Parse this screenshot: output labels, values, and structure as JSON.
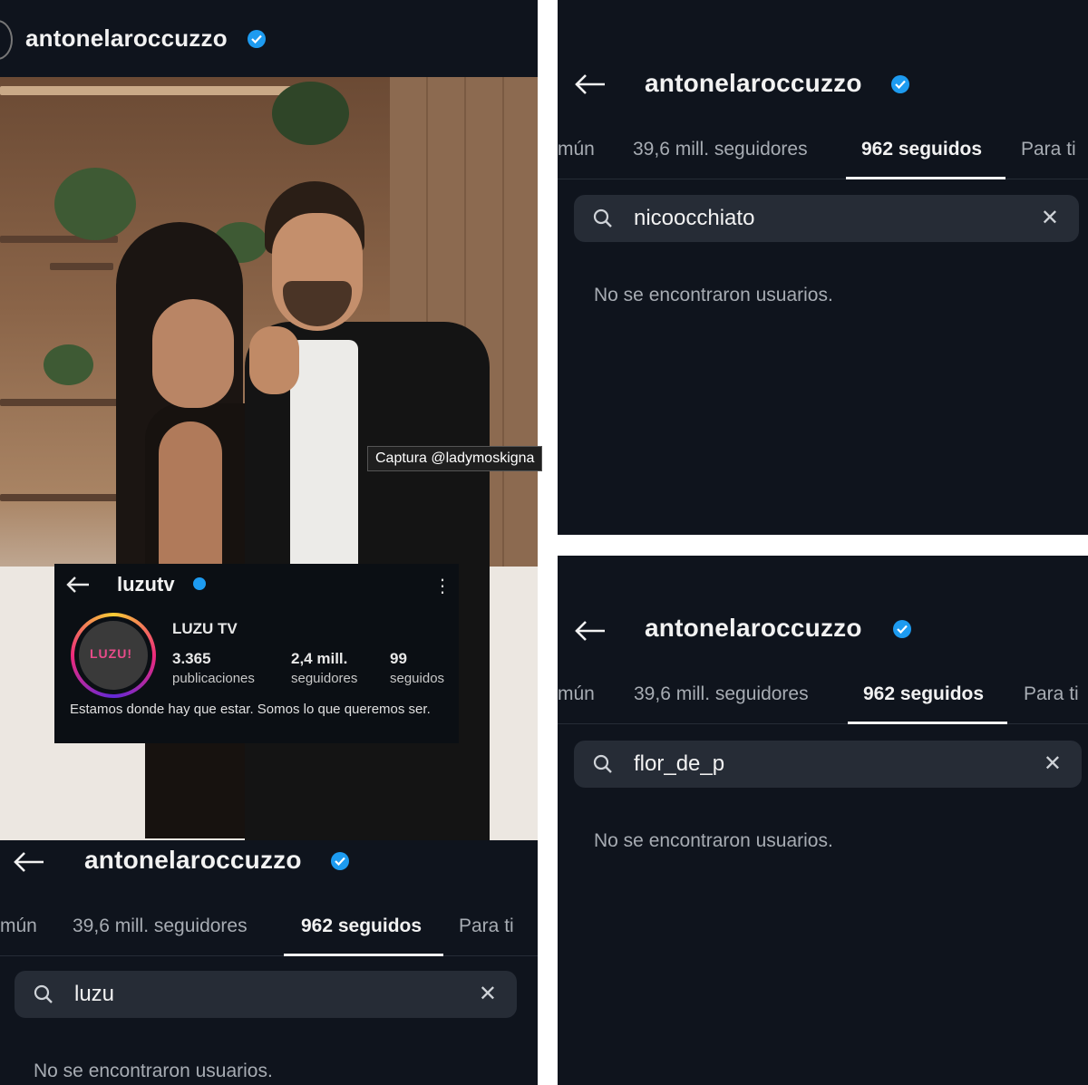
{
  "profile": {
    "username": "antonelaroccuzzo"
  },
  "tabs": [
    {
      "label": "mún"
    },
    {
      "label": "39,6 mill. seguidores"
    },
    {
      "label": "962 seguidos"
    },
    {
      "label": "Para ti"
    }
  ],
  "panels": [
    {
      "search_query": "nicoocchiato",
      "empty_message": "No se encontraron usuarios."
    },
    {
      "search_query": "flor_de_p",
      "empty_message": "No se encontraron usuarios."
    },
    {
      "search_query": "luzu",
      "empty_message": "No se encontraron usuarios."
    }
  ],
  "photo_caption": "Captura @ladymoskigna",
  "luzu_profile": {
    "username": "luzutv",
    "display_name": "LUZU TV",
    "avatar_text": "LUZU!",
    "stats": [
      {
        "number": "3.365",
        "label": "publicaciones"
      },
      {
        "number": "2,4 mill.",
        "label": "seguidores"
      },
      {
        "number": "99",
        "label": "seguidos"
      }
    ],
    "bio": "Estamos donde hay que estar. Somos lo que queremos ser."
  },
  "colors": {
    "background": "#0f141d",
    "verified": "#1d9bf0",
    "search_field": "#262c36"
  }
}
